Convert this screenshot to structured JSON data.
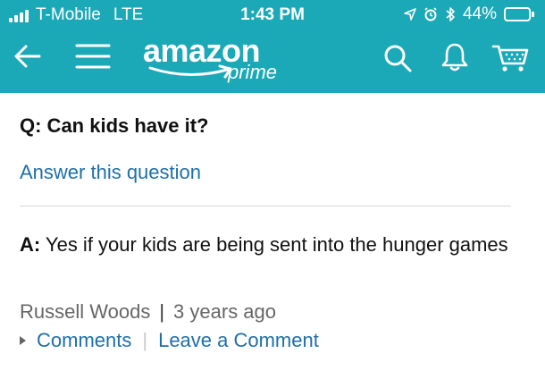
{
  "status_bar": {
    "carrier": "T-Mobile",
    "network": "LTE",
    "time": "1:43 PM",
    "battery": "44%",
    "battery_level": 0.44,
    "icons": [
      "location-arrow-icon",
      "alarm-icon",
      "bluetooth-icon"
    ]
  },
  "nav": {
    "logo_text": "amazon",
    "logo_subtext": "prime",
    "icons": [
      "back-arrow-icon",
      "menu-icon",
      "search-icon",
      "bell-icon",
      "cart-icon"
    ]
  },
  "qa": {
    "question": "Q: Can kids have it?",
    "answer_link": "Answer this question",
    "answer_prefix": "A:",
    "answer_text": " Yes if your kids are being sent into the hunger games",
    "author": "Russell Woods",
    "meta_separator": "|",
    "timestamp": "3 years ago",
    "comments_link": "Comments",
    "actions_separator": "|",
    "leave_comment_link": "Leave a Comment"
  },
  "colors": {
    "header_bg": "#1ba9b8",
    "link": "#1f6fa8",
    "battery_fill": "#f7c92d"
  }
}
